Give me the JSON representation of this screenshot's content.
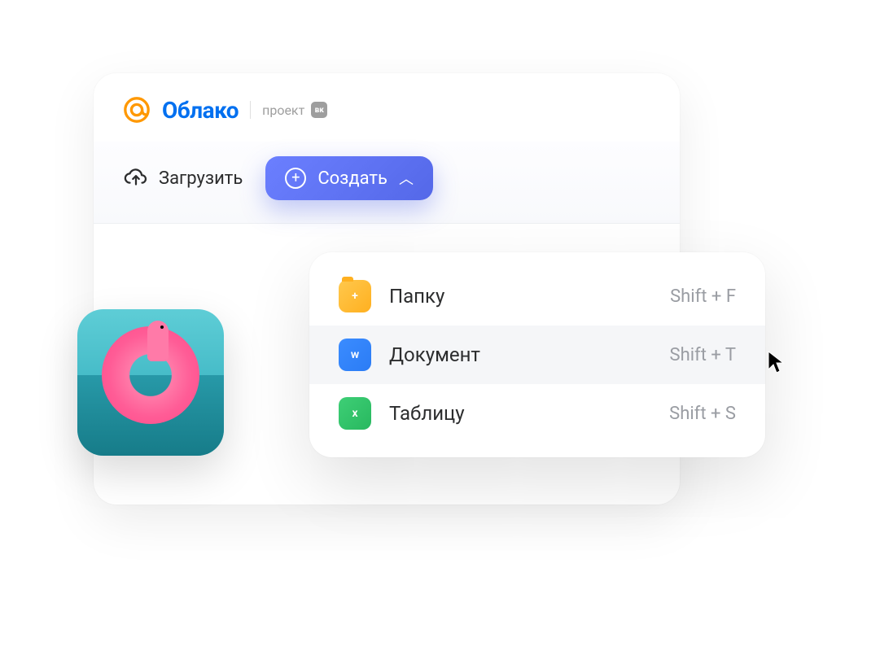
{
  "header": {
    "brand": "Облако",
    "project_label": "проект",
    "vk_badge": "вк"
  },
  "toolbar": {
    "upload_label": "Загрузить",
    "create_label": "Создать"
  },
  "dropdown": {
    "items": [
      {
        "label": "Папку",
        "shortcut": "Shift + F",
        "icon_glyph": "+"
      },
      {
        "label": "Документ",
        "shortcut": "Shift + T",
        "icon_glyph": "w"
      },
      {
        "label": "Таблицу",
        "shortcut": "Shift + S",
        "icon_glyph": "x"
      }
    ]
  }
}
